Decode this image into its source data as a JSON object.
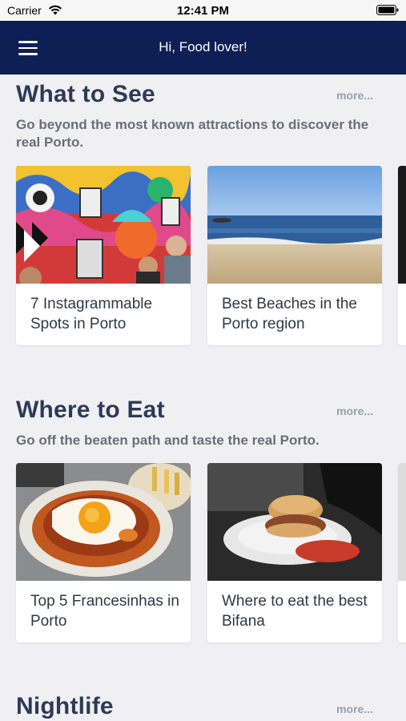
{
  "status_bar": {
    "carrier": "Carrier",
    "time": "12:41 PM"
  },
  "header": {
    "title": "Hi, Food lover!"
  },
  "sections": [
    {
      "title": "What to See",
      "more": "more...",
      "description": "Go beyond the most known attractions to discover the real Porto.",
      "cards": [
        {
          "label": "7 Instagrammable Spots in Porto",
          "image": "colorful-street-mural-photo"
        },
        {
          "label": "Best Beaches in the Porto region",
          "image": "beach-photo"
        }
      ]
    },
    {
      "title": "Where to Eat",
      "more": "more...",
      "description": "Go off the beaten path and taste the real Porto.",
      "cards": [
        {
          "label": "Top 5 Francesinhas in Porto",
          "image": "francesinha-dish-photo"
        },
        {
          "label": "Where to eat the best Bifana",
          "image": "bifana-sandwich-photo"
        }
      ]
    },
    {
      "title": "Nightlife",
      "more": "more..."
    }
  ]
}
